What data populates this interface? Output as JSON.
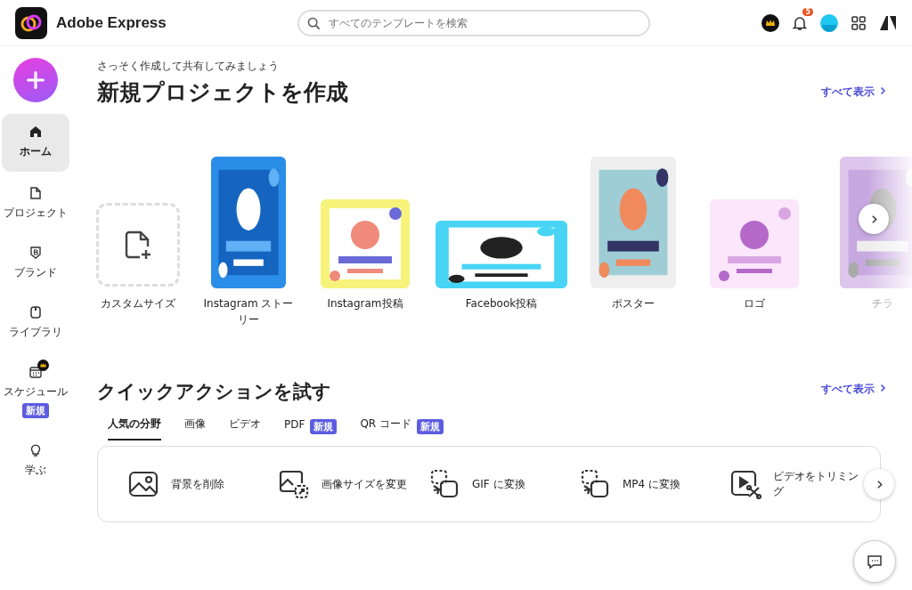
{
  "header": {
    "app_name": "Adobe Express",
    "search": {
      "placeholder": "すべてのテンプレートを検索"
    },
    "notification_count": "5"
  },
  "sidebar": {
    "items": [
      {
        "label": "ホーム",
        "selected": true
      },
      {
        "label": "プロジェクト",
        "selected": false
      },
      {
        "label": "ブランド",
        "selected": false
      },
      {
        "label": "ライブラリ",
        "selected": false
      },
      {
        "label": "スケジュール",
        "selected": false,
        "premium": true,
        "badge": "新規"
      },
      {
        "label": "学ぶ",
        "selected": false
      }
    ]
  },
  "create_section": {
    "subtitle": "さっそく作成して共有してみましょう",
    "title": "新規プロジェクトを作成",
    "see_all": "すべて表示",
    "templates": [
      {
        "label": "カスタムサイズ",
        "kind": "custom"
      },
      {
        "label": "Instagram ストーリー",
        "kind": "picture"
      },
      {
        "label": "Instagram投稿",
        "kind": "picture"
      },
      {
        "label": "Facebook投稿",
        "kind": "picture"
      },
      {
        "label": "ポスター",
        "kind": "picture"
      },
      {
        "label": "ロゴ",
        "kind": "picture"
      },
      {
        "label": "チラ",
        "kind": "picture"
      }
    ]
  },
  "quick_actions": {
    "title": "クイックアクションを試す",
    "see_all": "すべて表示",
    "tabs": [
      {
        "label": "人気の分野",
        "selected": true
      },
      {
        "label": "画像",
        "selected": false
      },
      {
        "label": "ビデオ",
        "selected": false
      },
      {
        "label": "PDF",
        "selected": false,
        "badge": "新規"
      },
      {
        "label": "QR コード",
        "selected": false,
        "badge": "新規"
      }
    ],
    "actions": [
      {
        "label": "背景を削除"
      },
      {
        "label": "画像サイズを変更"
      },
      {
        "label": "GIF に変換"
      },
      {
        "label": "MP4 に変換"
      },
      {
        "label": "ビデオをトリミング"
      }
    ]
  }
}
